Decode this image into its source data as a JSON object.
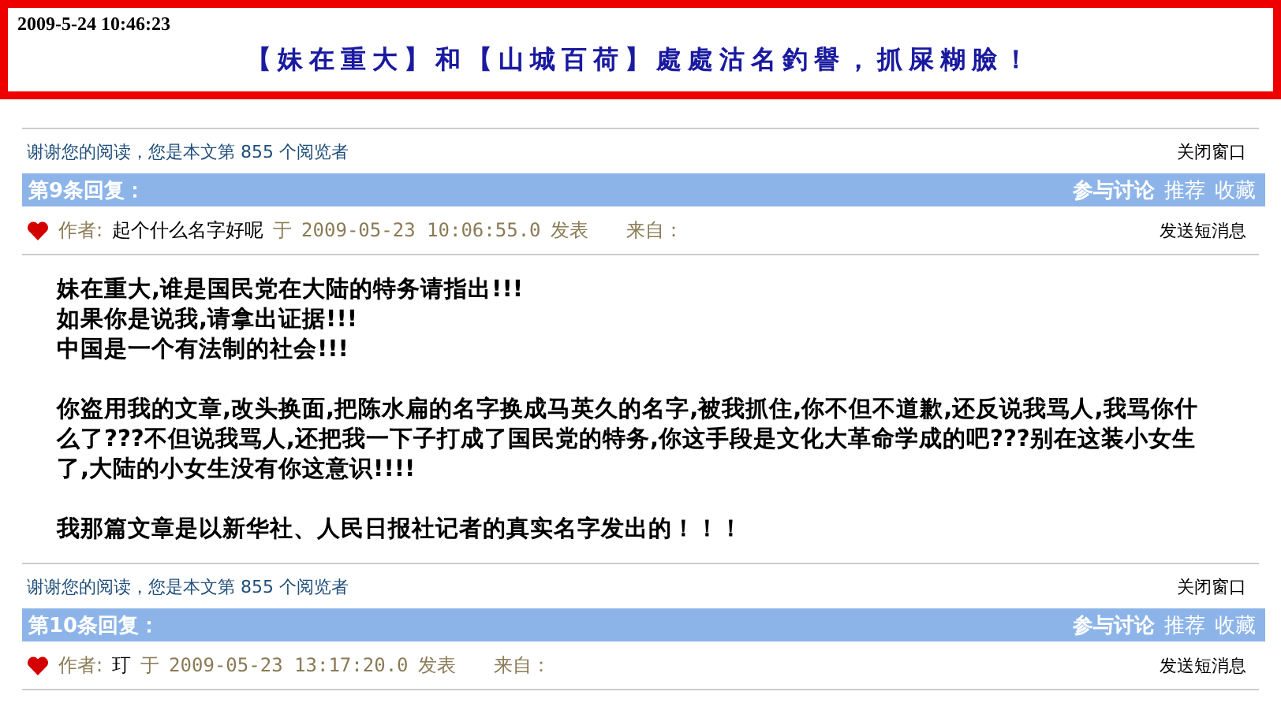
{
  "header": {
    "date": "2009-5-24 10:46:23",
    "title": "【妹在重大】和【山城百荷】處處沽名釣譽，抓屎糊臉！"
  },
  "posts": [
    {
      "reader_note": "谢谢您的阅读，您是本文第 855 个阅览者",
      "close_link": "关闭窗口",
      "reply_title": "第9条回复：",
      "actions": [
        "参与讨论",
        "推荐",
        "收藏"
      ],
      "author_label": "作者:",
      "author": "起个什么名字好呢",
      "at": "于",
      "posted": "2009-05-23 10:06:55.0",
      "posted_suffix": "发表",
      "from_label": "来自：",
      "message_link": "发送短消息",
      "body": [
        [
          "妹在重大,谁是国民党在大陆的特务请指出!!!",
          "如果你是说我,请拿出证据!!!",
          "中国是一个有法制的社会!!!"
        ],
        [
          "你盗用我的文章,改头换面,把陈水扁的名字换成马英久的名字,被我抓住,你不但不道歉,还反说我骂人,我骂你什么了???不但说我骂人,还把我一下子打成了国民党的特务,你这手段是文化大革命学成的吧???别在这装小女生了,大陆的小女生没有你这意识!!!!"
        ],
        [
          "我那篇文章是以新华社、人民日报社记者的真实名字发出的！！！"
        ]
      ]
    },
    {
      "reader_note": "谢谢您的阅读，您是本文第 855 个阅览者",
      "close_link": "关闭窗口",
      "reply_title": "第10条回复：",
      "actions": [
        "参与讨论",
        "推荐",
        "收藏"
      ],
      "author_label": "作者:",
      "author": "玎",
      "at": "于",
      "posted": "2009-05-23 13:17:20.0",
      "posted_suffix": "发表",
      "from_label": "来自：",
      "message_link": "发送短消息"
    }
  ]
}
